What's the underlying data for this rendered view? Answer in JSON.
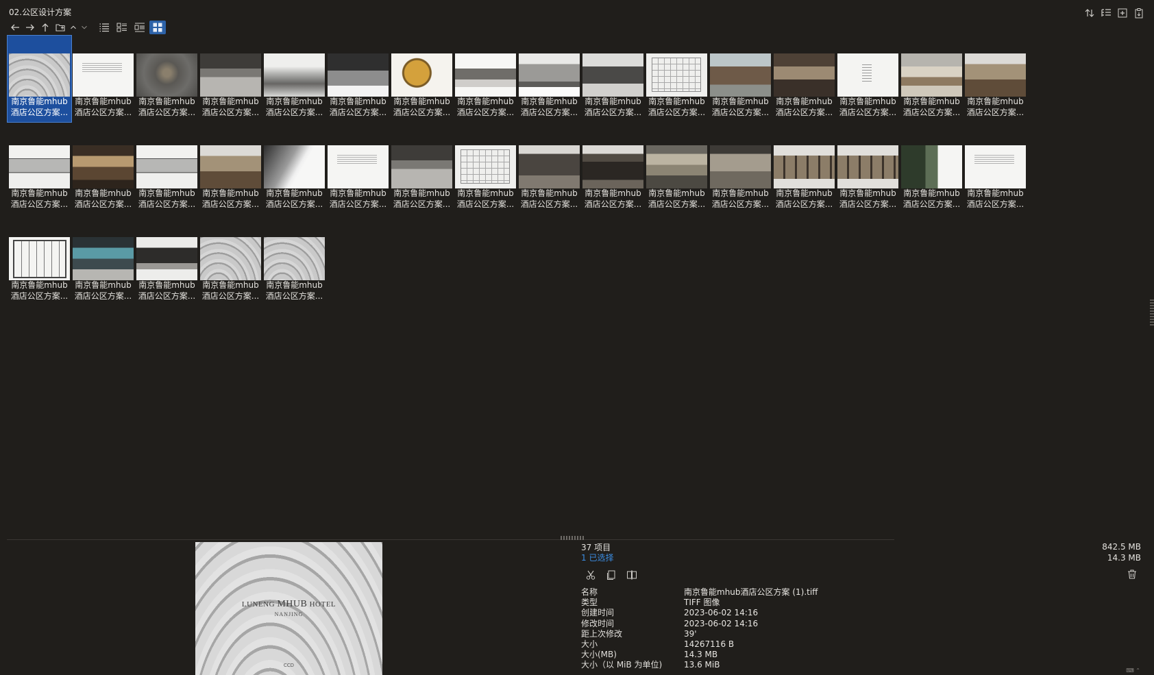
{
  "window": {
    "title": "02.公区设计方案"
  },
  "toolbar": {
    "icons": [
      "back-arrow-icon",
      "forward-arrow-icon",
      "up-arrow-icon",
      "folder-open-icon",
      "chevron-up-icon",
      "chevron-down-icon",
      "details-view-icon",
      "tiles-list-view-icon",
      "content-view-icon",
      "thumbnail-view-icon"
    ],
    "active_view": "thumbnail-view-icon",
    "right_icons": [
      "sort-icon",
      "tree-view-icon",
      "new-item-icon",
      "paste-icon"
    ]
  },
  "files": {
    "count": 37,
    "caption_line1": "南京鲁能mhub",
    "caption_line2": "酒店公区方案...",
    "selected_index": 0,
    "thumbs": [
      "roofs",
      "textdoc",
      "aerial",
      "sketch",
      "mist",
      "map",
      "gold",
      "pavilion",
      "trees",
      "temple",
      "plan",
      "gate",
      "interior-warm",
      "white",
      "bright",
      "lobby",
      "strip",
      "hall",
      "strip",
      "lobby",
      "blur",
      "textdoc",
      "sketch",
      "plan",
      "dark",
      "darkwall",
      "ballroom",
      "ballroom2",
      "panel",
      "panel",
      "green",
      "textdoc",
      "plan2",
      "pool",
      "elev",
      "roofs",
      "roofs"
    ]
  },
  "preview": {
    "brand_prefix": "LUNENG ",
    "brand_main": "MHUB",
    "brand_suffix": " HOTEL",
    "city": "NANJING",
    "mark": "CCD"
  },
  "status": {
    "item_count": "37 项目",
    "selected": "1 已选择",
    "total_size": "842.5 MB",
    "selected_size": "14.3 MB"
  },
  "properties": [
    {
      "key": "名称",
      "value": "南京鲁能mhub酒店公区方案 (1).tiff"
    },
    {
      "key": "类型",
      "value": "TIFF 图像"
    },
    {
      "key": "创建时间",
      "value": "2023-06-02  14:16"
    },
    {
      "key": "修改时间",
      "value": "2023-06-02  14:16"
    },
    {
      "key": "距上次修改",
      "value": "39'"
    },
    {
      "key": "大小",
      "value": "14267116 B"
    },
    {
      "key": "大小(MB)",
      "value": "14.3 MB"
    },
    {
      "key": "大小（以 MiB 为单位)",
      "value": "13.6 MiB"
    }
  ],
  "footer": {
    "corner_text": "⌨ ⌃"
  }
}
